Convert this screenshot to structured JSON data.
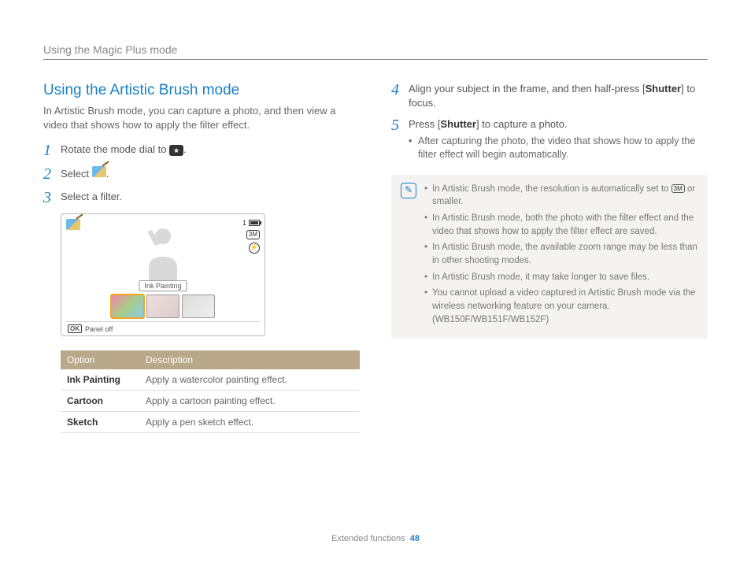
{
  "header": {
    "breadcrumb": "Using the Magic Plus mode"
  },
  "section": {
    "title": "Using the Artistic Brush mode",
    "intro": "In Artistic Brush mode, you can capture a photo, and then view a video that shows how to apply the filter effect."
  },
  "steps": {
    "s1": {
      "num": "1",
      "pre": "Rotate the mode dial to ",
      "post": "."
    },
    "s2": {
      "num": "2",
      "pre": "Select ",
      "post": "."
    },
    "s3": {
      "num": "3",
      "text": "Select a filter."
    },
    "s4": {
      "num": "4",
      "pre": "Align your subject in the frame, and then half-press [",
      "bold": "Shutter",
      "post": "] to focus."
    },
    "s5": {
      "num": "5",
      "pre": "Press [",
      "bold": "Shutter",
      "post": "] to capture a photo."
    },
    "s5_sub": "After capturing the photo, the video that shows how to apply the filter effect will begin automatically."
  },
  "screen": {
    "top_left_icon": "palette",
    "top_right_count": "1",
    "badge_3m": "3M",
    "label": "Ink Painting",
    "footer_ok": "OK",
    "footer_text": "Panel off"
  },
  "table": {
    "headers": {
      "option": "Option",
      "description": "Description"
    },
    "rows": [
      {
        "k": "Ink Painting",
        "v": "Apply a watercolor painting effect."
      },
      {
        "k": "Cartoon",
        "v": "Apply a cartoon painting effect."
      },
      {
        "k": "Sketch",
        "v": "Apply a pen sketch effect."
      }
    ]
  },
  "notes": {
    "n1_pre": "In Artistic Brush mode, the resolution is automatically set to ",
    "n1_badge": "3M",
    "n1_post": " or smaller.",
    "n2": "In Artistic Brush mode, both the photo with the filter effect and the video that shows how to apply the filter effect are saved.",
    "n3": "In Artistic Brush mode, the available zoom range may be less than in other shooting modes.",
    "n4": "In Artistic Brush mode, it may take longer to save files.",
    "n5": "You cannot upload a video captured in Artistic Brush mode via the wireless networking feature on your camera. (WB150F/WB151F/WB152F)"
  },
  "footer": {
    "section": "Extended functions",
    "page": "48"
  }
}
